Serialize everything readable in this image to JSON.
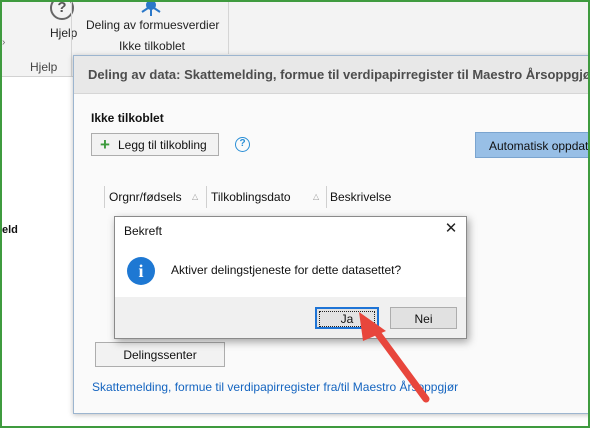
{
  "ribbon": {
    "help_label": "Hjelp",
    "help_icon": "?",
    "help_group_label": "Hjelp",
    "share_label": "Deling av formuesverdier",
    "share_status": "Ikke tilkoblet"
  },
  "left_panel": {
    "fragment_label": "eld"
  },
  "window": {
    "title": "Deling av data: Skattemelding, formue til verdipapirregister til Maestro Årsoppgjør",
    "connection_heading": "Ikke tilkoblet",
    "add_connection_button": "Legg til tilkobling",
    "help_icon": "?",
    "auto_update_button": "Automatisk oppdatering",
    "grid_columns": [
      "Orgnr/fødsels",
      "Tilkoblingsdato",
      "Beskrivelse"
    ],
    "sharing_center_button": "Delingssenter",
    "link_text": "Skattemelding, formue til verdipapirregister fra/til Maestro Årsoppgjør"
  },
  "dialog": {
    "title": "Bekreft",
    "close_glyph": "✕",
    "info_glyph": "i",
    "message": "Aktiver delingstjeneste for dette datasettet?",
    "yes_button": "Ja",
    "no_button": "Nei"
  },
  "colors": {
    "frame_border": "#3f9b3f",
    "accent_button": "#98bfe6",
    "info_icon": "#1e78d3",
    "link": "#1565c0",
    "annotation_arrow": "#e8463c"
  }
}
